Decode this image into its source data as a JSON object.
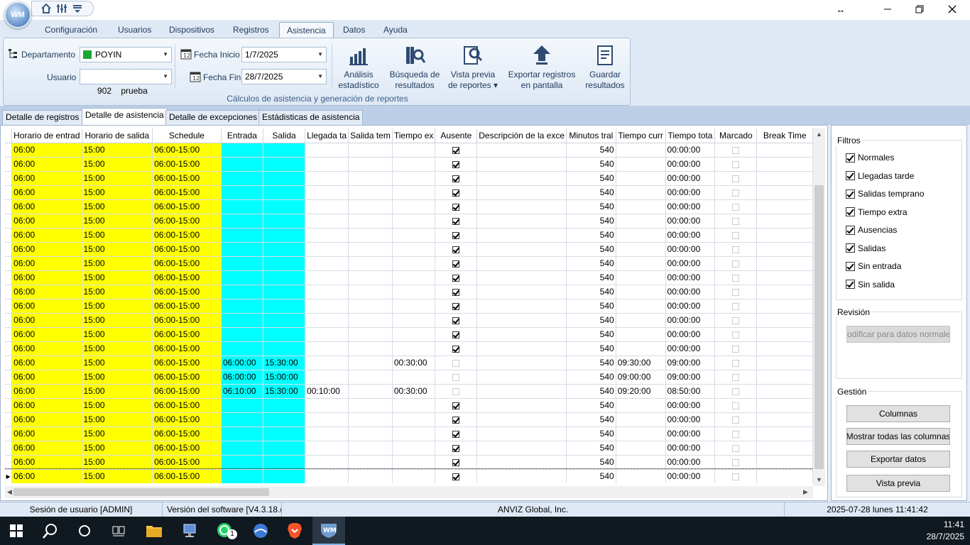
{
  "window": {
    "logo_text": "WM"
  },
  "menu": {
    "tabs": [
      "Configuración",
      "Usuarios",
      "Dispositivos",
      "Registros",
      "Asistencia",
      "Datos",
      "Ayuda"
    ],
    "active": "Asistencia"
  },
  "ribbon": {
    "departamento_label": "Departamento",
    "departamento_value": "POYIN",
    "usuario_label": "Usuario",
    "usuario_value": "902    prueba",
    "fecha_inicio_label": "Fecha Inicio",
    "fecha_inicio_value": "1/7/2025",
    "fecha_fin_label": "Fecha Fin",
    "fecha_fin_value": "28/7/2025",
    "buttons": [
      {
        "line1": "Análisis",
        "line2": "estadístico"
      },
      {
        "line1": "Búsqueda de",
        "line2": "resultados"
      },
      {
        "line1": "Vista previa",
        "line2": "de reportes ▾"
      },
      {
        "line1": "Exportar registros",
        "line2": "en pantalla"
      },
      {
        "line1": "Guardar",
        "line2": "resultados"
      }
    ],
    "group_label": "Cálculos de asistencia y generación de reportes"
  },
  "subtabs": [
    "Detalle de registros",
    "Detalle de asistencia",
    "Detalle de excepciones",
    "Estádisticas de asistencia"
  ],
  "grid": {
    "columns": [
      "Horario de entrad",
      "Horario de salida",
      "Schedule",
      "Entrada",
      "Salida",
      "Llegada ta",
      "Salida tem",
      "Tiempo ex",
      "Ausente",
      "Descripción de la exce",
      "Minutos tral",
      "Tiempo curr",
      "Tiempo tota",
      "Marcado",
      "Break Time"
    ],
    "rows": [
      [
        "06:00",
        "15:00",
        "06:00-15:00",
        "",
        "",
        "",
        "",
        "",
        true,
        "",
        "540",
        "",
        "00:00:00",
        false,
        ""
      ],
      [
        "06:00",
        "15:00",
        "06:00-15:00",
        "",
        "",
        "",
        "",
        "",
        true,
        "",
        "540",
        "",
        "00:00:00",
        false,
        ""
      ],
      [
        "06:00",
        "15:00",
        "06:00-15:00",
        "",
        "",
        "",
        "",
        "",
        true,
        "",
        "540",
        "",
        "00:00:00",
        false,
        ""
      ],
      [
        "06:00",
        "15:00",
        "06:00-15:00",
        "",
        "",
        "",
        "",
        "",
        true,
        "",
        "540",
        "",
        "00:00:00",
        false,
        ""
      ],
      [
        "06:00",
        "15:00",
        "06:00-15:00",
        "",
        "",
        "",
        "",
        "",
        true,
        "",
        "540",
        "",
        "00:00:00",
        false,
        ""
      ],
      [
        "06:00",
        "15:00",
        "06:00-15:00",
        "",
        "",
        "",
        "",
        "",
        true,
        "",
        "540",
        "",
        "00:00:00",
        false,
        ""
      ],
      [
        "06:00",
        "15:00",
        "06:00-15:00",
        "",
        "",
        "",
        "",
        "",
        true,
        "",
        "540",
        "",
        "00:00:00",
        false,
        ""
      ],
      [
        "06:00",
        "15:00",
        "06:00-15:00",
        "",
        "",
        "",
        "",
        "",
        true,
        "",
        "540",
        "",
        "00:00:00",
        false,
        ""
      ],
      [
        "06:00",
        "15:00",
        "06:00-15:00",
        "",
        "",
        "",
        "",
        "",
        true,
        "",
        "540",
        "",
        "00:00:00",
        false,
        ""
      ],
      [
        "06:00",
        "15:00",
        "06:00-15:00",
        "",
        "",
        "",
        "",
        "",
        true,
        "",
        "540",
        "",
        "00:00:00",
        false,
        ""
      ],
      [
        "06:00",
        "15:00",
        "06:00-15:00",
        "",
        "",
        "",
        "",
        "",
        true,
        "",
        "540",
        "",
        "00:00:00",
        false,
        ""
      ],
      [
        "06:00",
        "15:00",
        "06:00-15:00",
        "",
        "",
        "",
        "",
        "",
        true,
        "",
        "540",
        "",
        "00:00:00",
        false,
        ""
      ],
      [
        "06:00",
        "15:00",
        "06:00-15:00",
        "",
        "",
        "",
        "",
        "",
        true,
        "",
        "540",
        "",
        "00:00:00",
        false,
        ""
      ],
      [
        "06:00",
        "15:00",
        "06:00-15:00",
        "",
        "",
        "",
        "",
        "",
        true,
        "",
        "540",
        "",
        "00:00:00",
        false,
        ""
      ],
      [
        "06:00",
        "15:00",
        "06:00-15:00",
        "",
        "",
        "",
        "",
        "",
        true,
        "",
        "540",
        "",
        "00:00:00",
        false,
        ""
      ],
      [
        "06:00",
        "15:00",
        "06:00-15:00",
        "06:00:00",
        "15:30:00",
        "",
        "",
        "00:30:00",
        false,
        "",
        "540",
        "09:30:00",
        "09:00:00",
        false,
        ""
      ],
      [
        "06:00",
        "15:00",
        "06:00-15:00",
        "06:00:00",
        "15:00:00",
        "",
        "",
        "",
        false,
        "",
        "540",
        "09:00:00",
        "09:00:00",
        false,
        ""
      ],
      [
        "06:00",
        "15:00",
        "06:00-15:00",
        "06:10:00",
        "15:30:00",
        "00:10:00",
        "",
        "00:30:00",
        false,
        "",
        "540",
        "09:20:00",
        "08:50:00",
        false,
        ""
      ],
      [
        "06:00",
        "15:00",
        "06:00-15:00",
        "",
        "",
        "",
        "",
        "",
        true,
        "",
        "540",
        "",
        "00:00:00",
        false,
        ""
      ],
      [
        "06:00",
        "15:00",
        "06:00-15:00",
        "",
        "",
        "",
        "",
        "",
        true,
        "",
        "540",
        "",
        "00:00:00",
        false,
        ""
      ],
      [
        "06:00",
        "15:00",
        "06:00-15:00",
        "",
        "",
        "",
        "",
        "",
        true,
        "",
        "540",
        "",
        "00:00:00",
        false,
        ""
      ],
      [
        "06:00",
        "15:00",
        "06:00-15:00",
        "",
        "",
        "",
        "",
        "",
        true,
        "",
        "540",
        "",
        "00:00:00",
        false,
        ""
      ],
      [
        "06:00",
        "15:00",
        "06:00-15:00",
        "",
        "",
        "",
        "",
        "",
        true,
        "",
        "540",
        "",
        "00:00:00",
        false,
        ""
      ],
      [
        "06:00",
        "15:00",
        "06:00-15:00",
        "",
        "",
        "",
        "",
        "",
        true,
        "",
        "540",
        "",
        "00:00:00",
        false,
        ""
      ]
    ]
  },
  "filters": {
    "title": "Filtros",
    "items": [
      {
        "label": "Normales",
        "checked": true
      },
      {
        "label": "Llegadas tarde",
        "checked": true
      },
      {
        "label": "Salidas temprano",
        "checked": true
      },
      {
        "label": "Tiempo extra",
        "checked": true
      },
      {
        "label": "Ausencias",
        "checked": true
      },
      {
        "label": "Salidas",
        "checked": true
      },
      {
        "label": "Sin entrada",
        "checked": true
      },
      {
        "label": "Sin salida",
        "checked": true
      }
    ]
  },
  "revision": {
    "title": "Revisión",
    "button": "odificar para datos normale"
  },
  "gestion": {
    "title": "Gestión",
    "buttons": [
      "Columnas",
      "Mostrar todas las columnas",
      "Exportar datos",
      "Vista previa"
    ]
  },
  "status": {
    "session": "Sesión de usuario  [ADMIN]",
    "version": "Versión del software  [V4.3.18.(",
    "company": "ANVIZ Global, Inc.",
    "datetime": "2025-07-28 lunes 11:41:42"
  },
  "taskbar": {
    "time": "11:41",
    "date": "28/7/2025",
    "badge": "1"
  },
  "colors": {
    "yellow": "#ffff00",
    "cyan": "#00ffff",
    "ribbon_text": "#1e395b"
  }
}
